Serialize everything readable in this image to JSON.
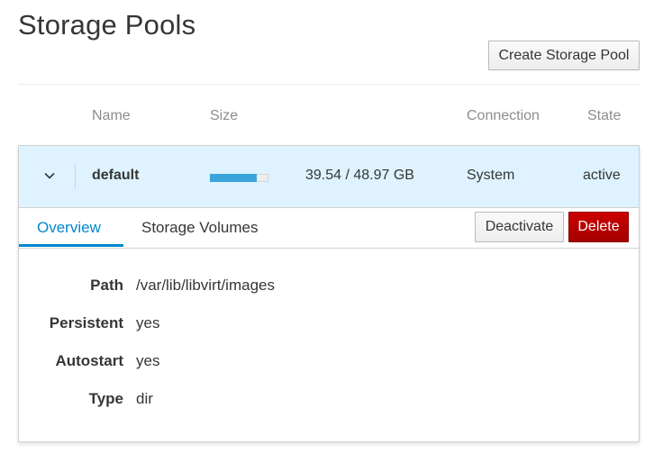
{
  "page": {
    "title": "Storage Pools",
    "create_button": "Create Storage Pool"
  },
  "table": {
    "headers": [
      "Name",
      "Size",
      "Connection",
      "State"
    ],
    "pools": [
      {
        "name": "default",
        "usage_fraction": 0.807,
        "size_text": "39.54 / 48.97 GB",
        "connection": "System",
        "state": "active",
        "expanded": true,
        "tabs": [
          {
            "label": "Overview",
            "active": true
          },
          {
            "label": "Storage Volumes",
            "active": false
          }
        ],
        "actions": {
          "deactivate": "Deactivate",
          "delete": "Delete"
        },
        "overview": [
          {
            "label": "Path",
            "value": "/var/lib/libvirt/images"
          },
          {
            "label": "Persistent",
            "value": "yes"
          },
          {
            "label": "Autostart",
            "value": "yes"
          },
          {
            "label": "Type",
            "value": "dir"
          }
        ]
      }
    ]
  },
  "colors": {
    "accent": "#0088ce",
    "progress": "#39a5dc",
    "row_selected": "#def3ff",
    "danger": "#cc0000"
  }
}
